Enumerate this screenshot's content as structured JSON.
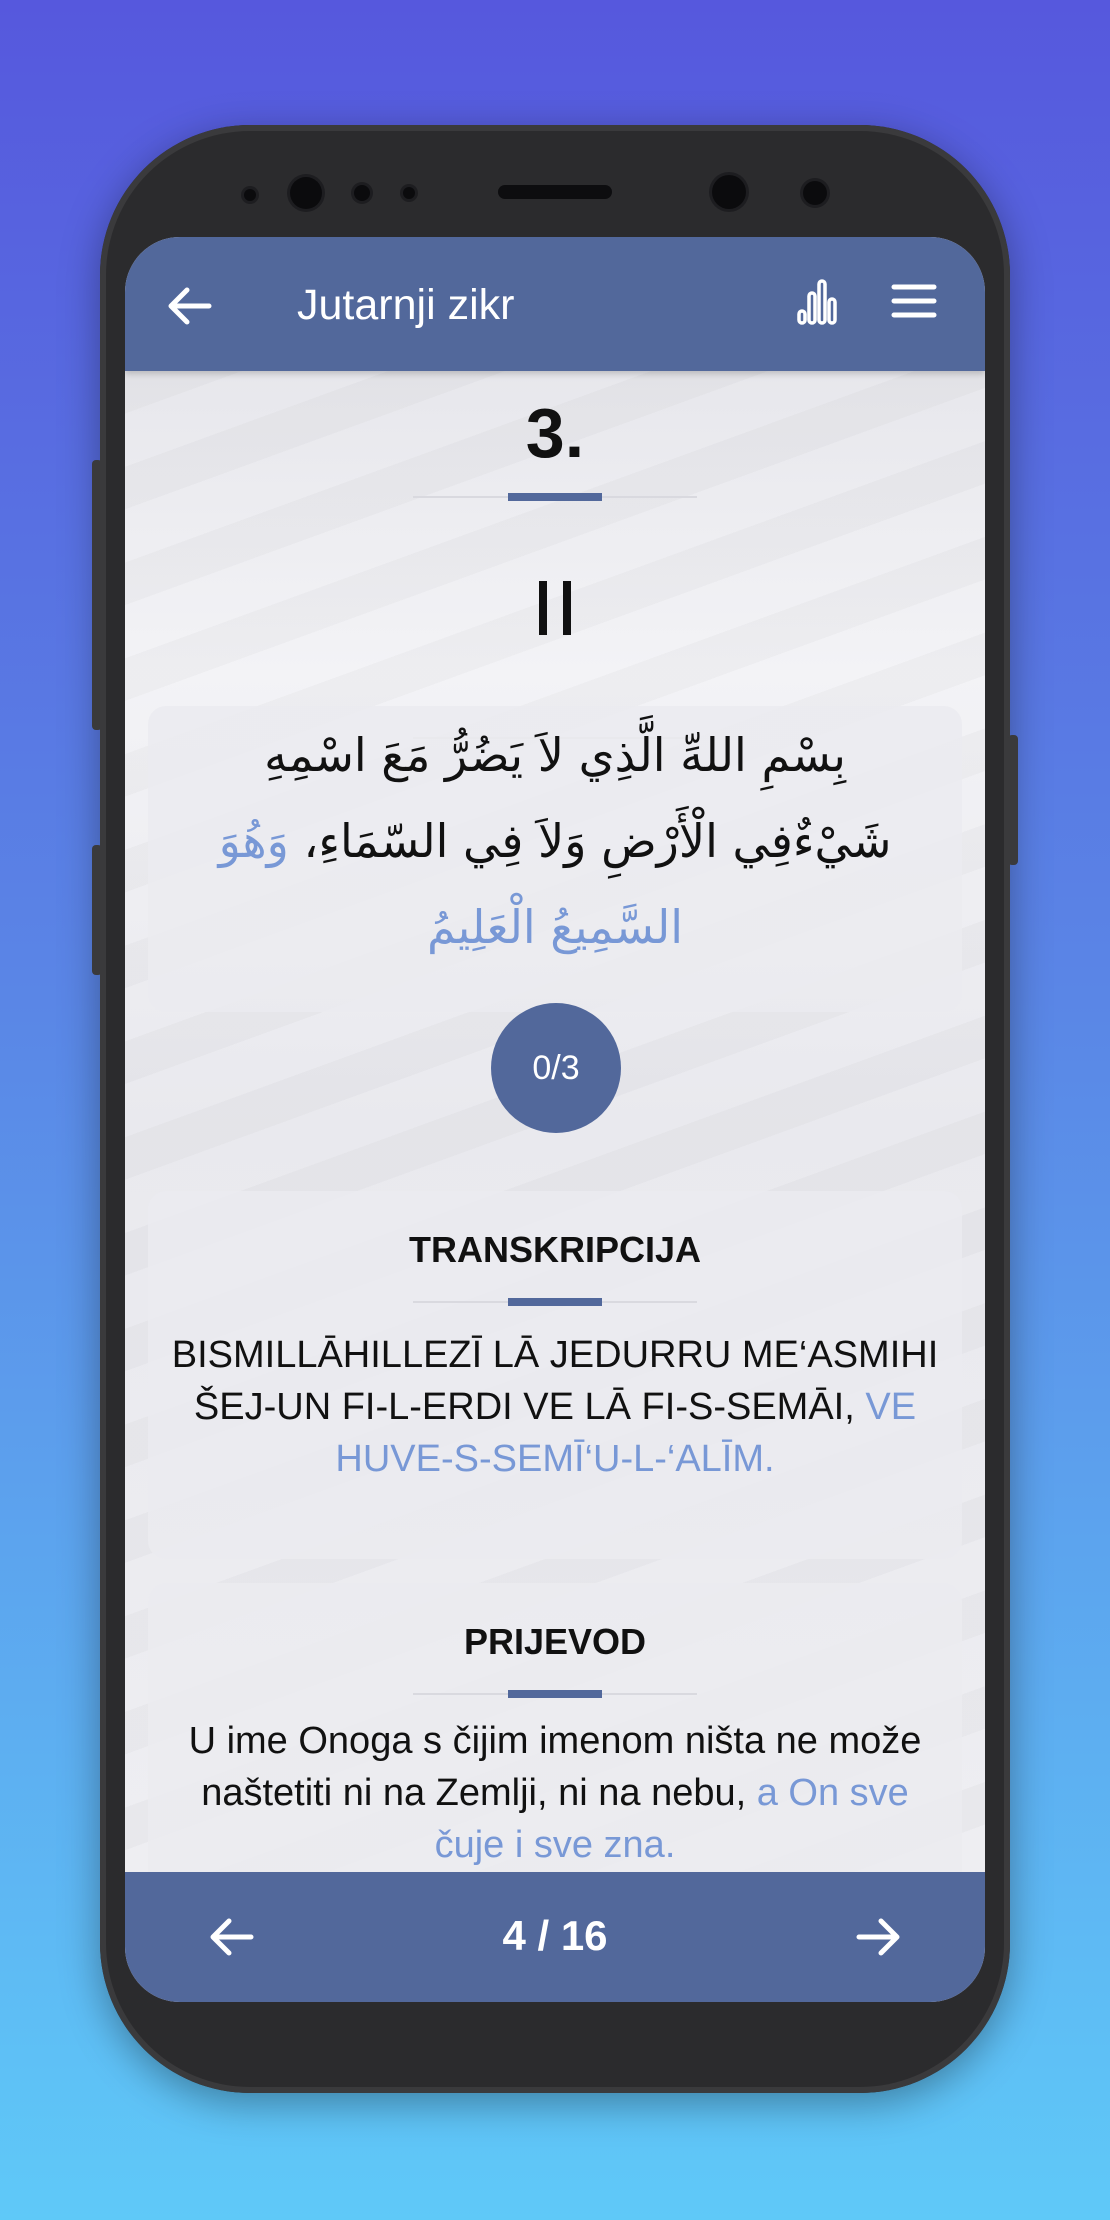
{
  "app": {
    "title": "Jutarnji zikr",
    "accent_color": "#52689b",
    "highlight_color": "#7898d6"
  },
  "header": {
    "back_icon": "arrow-left-icon",
    "stats_icon": "bar-chart-icon",
    "menu_icon": "hamburger-menu-icon"
  },
  "zikr": {
    "number": "3.",
    "audio_state_icon": "pause-icon",
    "arabic_main": "بِسْمِ اللهِّ الَّذِي لاَ يَضُرُّ مَعَ اسْمِهِ شَيْءٌفِي الْأَرْضِ وَلاَ فِي السّمَاءِ،",
    "arabic_highlight": "وَهُوَ السَّمِيعُ الْعَلِيمُ",
    "counter": "0/3"
  },
  "transcription": {
    "title": "TRANSKRIPCIJA",
    "text_main": "BISMILLĀHILLEZĪ LĀ JEDURRU ME‘ASMIHI ŠEJ-UN  FI-L-ERDI  VE LĀ FI-S-SEMĀI,",
    "text_highlight": "VE HUVE-S-SEMĪ‘U-L-‘ALĪM."
  },
  "translation": {
    "title": "PRIJEVOD",
    "text_main": "U ime Onoga s čijim imenom ništa ne može naštetiti ni na Zemlji, ni na nebu,",
    "text_highlight": "a On sve čuje i sve zna."
  },
  "footer": {
    "prev_icon": "arrow-left-icon",
    "next_icon": "arrow-right-icon",
    "pager": "4 / 16"
  }
}
